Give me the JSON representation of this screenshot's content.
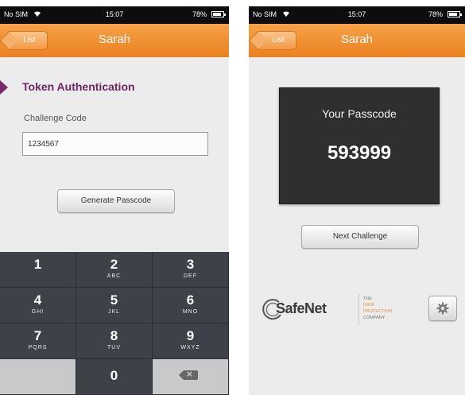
{
  "left_screen": {
    "status": {
      "carrier": "No SIM",
      "time": "15:07",
      "battery": "78%"
    },
    "nav": {
      "back_label": "List",
      "title": "Sarah"
    },
    "section_title": "Token Authentication",
    "challenge_label": "Challenge Code",
    "challenge_value": "1234567",
    "generate_label": "Generate Passcode",
    "keypad": [
      {
        "num": "1",
        "letters": ""
      },
      {
        "num": "2",
        "letters": "ABC"
      },
      {
        "num": "3",
        "letters": "DEF"
      },
      {
        "num": "4",
        "letters": "GHI"
      },
      {
        "num": "5",
        "letters": "JKL"
      },
      {
        "num": "6",
        "letters": "MNO"
      },
      {
        "num": "7",
        "letters": "PQRS"
      },
      {
        "num": "8",
        "letters": "TUV"
      },
      {
        "num": "9",
        "letters": "WXYZ"
      },
      {
        "num": "0",
        "letters": ""
      }
    ]
  },
  "right_screen": {
    "status": {
      "carrier": "No SIM",
      "time": "15:07",
      "battery": "78%"
    },
    "nav": {
      "back_label": "List",
      "title": "Sarah"
    },
    "passcode_label": "Your Passcode",
    "passcode_value": "593999",
    "next_label": "Next Challenge",
    "logo": {
      "brand": "SafeNet",
      "tagline": [
        "THE",
        "DATA",
        "PROTECTION",
        "COMPANY"
      ]
    },
    "settings_icon": "gear-icon"
  },
  "colors": {
    "accent_orange": "#ef8f2f",
    "section_purple": "#6d2566",
    "keyboard_dark": "#3e4148",
    "passcode_bg": "#2f2f2f"
  }
}
